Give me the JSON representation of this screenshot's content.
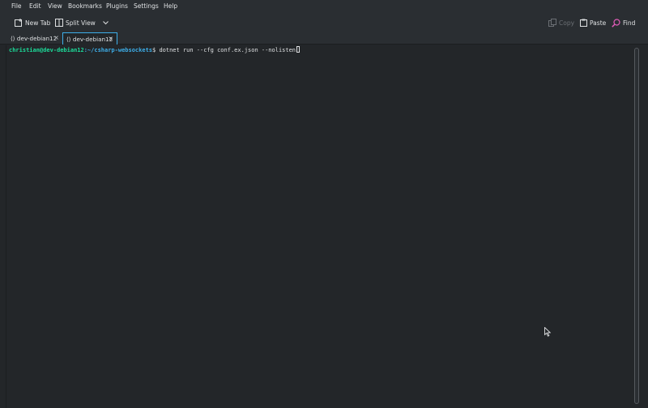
{
  "menu": {
    "items": [
      "File",
      "Edit",
      "View",
      "Bookmarks",
      "Plugins",
      "Settings",
      "Help"
    ]
  },
  "toolbar": {
    "new_tab": "New Tab",
    "split_view": "Split View",
    "copy": "Copy",
    "paste": "Paste",
    "find": "Find"
  },
  "tabs": [
    {
      "label": "⟨⟩ dev-debian12",
      "active": false
    },
    {
      "label": "⟨⟩ dev-debian12",
      "active": true
    }
  ],
  "terminal": {
    "user_host": "christian@dev-debian12",
    "path": ":~/csharp-websockets",
    "prompt_symbol": "$",
    "command": " dotnet run --cfg conf.ex.json --nolisten"
  },
  "colors": {
    "accent": "#3daee9",
    "prompt_user": "#1cdc9a",
    "background": "#232629"
  }
}
